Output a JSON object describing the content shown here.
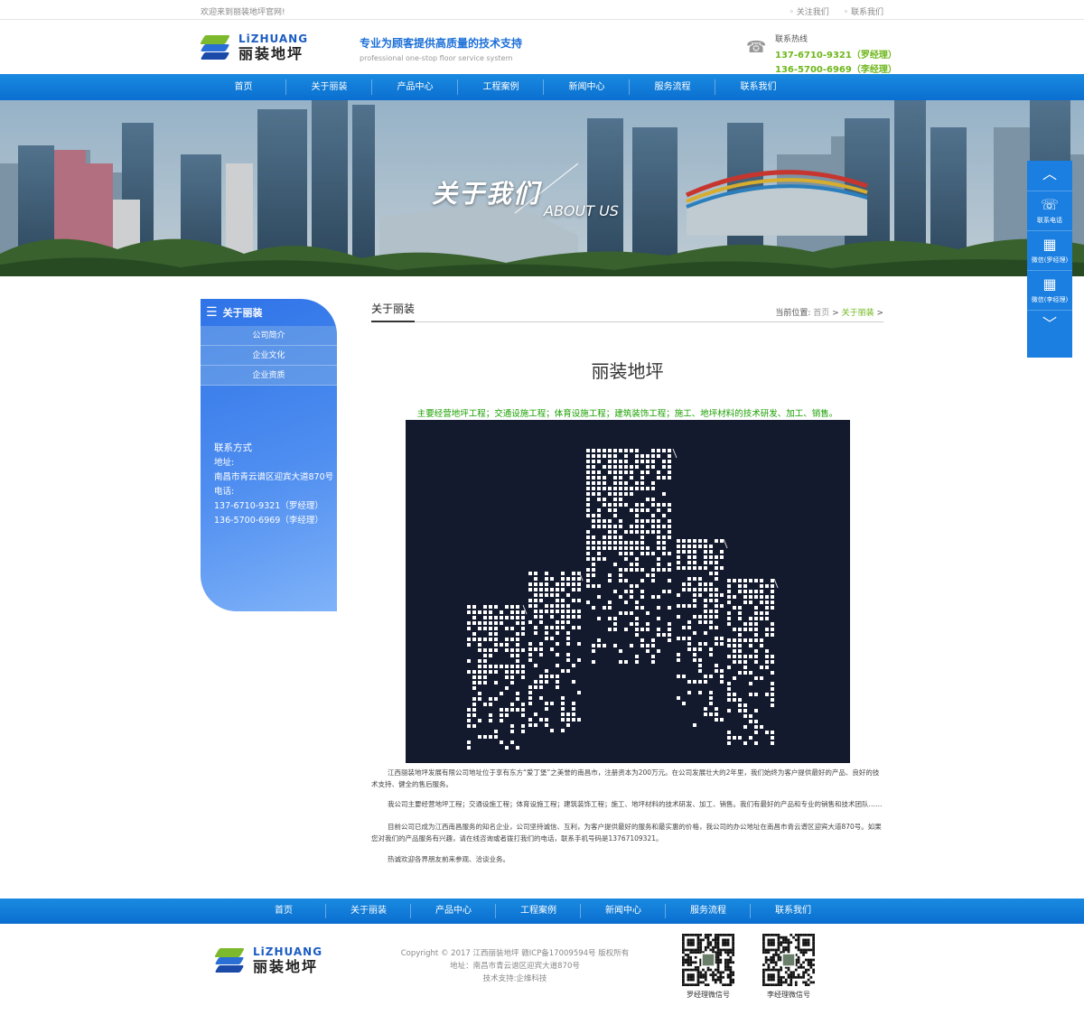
{
  "topbar": {
    "welcome": "欢迎来到丽装地坪官网!",
    "follow": "关注我们",
    "contact": "联系我们"
  },
  "header": {
    "logo_en": "LiZHUANG",
    "logo_cn": "丽装地坪",
    "slogan_cn": "专业为顾客提供高质量的技术支持",
    "slogan_en": "professional one-stop floor service system",
    "hotline_label": "联系热线",
    "phone1": "137-6710-9321（罗经理）",
    "phone2": "136-5700-6969（李经理）"
  },
  "nav": [
    "首页",
    "关于丽装",
    "产品中心",
    "工程案例",
    "新闻中心",
    "服务流程",
    "联系我们"
  ],
  "banner": {
    "title": "关于我们",
    "subtitle": "ABOUT US"
  },
  "float": {
    "phone": "联系电话",
    "wechat1": "微信(罗经理)",
    "wechat2": "微信(李经理)"
  },
  "sidebar": {
    "title": "关于丽装",
    "items": [
      "公司简介",
      "企业文化",
      "企业资质"
    ],
    "contact_title": "联系方式",
    "addr_label": "地址:",
    "addr": "南昌市青云谱区迎宾大道870号",
    "tel_label": "电话:",
    "tel1": "137-6710-9321（罗经理）",
    "tel2": "136-5700-6969（李经理）"
  },
  "main": {
    "title": "关于丽装",
    "crumb_label": "当前位置:",
    "crumb_home": "首页",
    "crumb_sep": ">",
    "crumb_current": "关于丽装",
    "company": "丽装地坪",
    "scope": "主要经营地坪工程；交通设施工程；体育设施工程；建筑装饰工程；施工、地坪材料的技术研发、加工、销售。",
    "p1": "江西丽装地坪发展有限公司地址位于享有东方“爱丁堡”之美誉的南昌市，注册资本为200万元。在公司发展壮大的2年里，我们始终为客户提供最好的产品、良好的技术支持、健全的售后服务。",
    "p2": "我公司主要经营地坪工程；交通设施工程；体育设施工程；建筑装饰工程；施工、地坪材料的技术研发、加工、销售。我们有最好的产品和专业的销售和技术团队……",
    "p3": "目前公司已成为江西南昌服务的知名企业，公司坚持诚信、互利，为客户提供最好的服务和最实惠的价格，我公司的办公地址在南昌市青云谱区迎宾大道870号。如果您对我们的产品服务有兴趣，请在线咨询或者拨打我们的电话，联系手机号码是13767109321。",
    "p4": "热诚欢迎各界朋友前来参观、洽谈业务。"
  },
  "footer_nav": [
    "首页",
    "关于丽装",
    "产品中心",
    "工程案例",
    "新闻中心",
    "服务流程",
    "联系我们"
  ],
  "footer": {
    "copyright": "Copyright © 2017 江西丽装地坪 赣ICP备17009594号 版权所有",
    "address": "地址：南昌市青云谱区迎宾大道870号",
    "support": "技术支持:企维科技",
    "qr1": "罗经理微信号",
    "qr2": "李经理微信号"
  },
  "colors": {
    "brand_blue": "#0a6fd0",
    "accent_green": "#6eb71b",
    "scope_green": "#1aa000"
  }
}
